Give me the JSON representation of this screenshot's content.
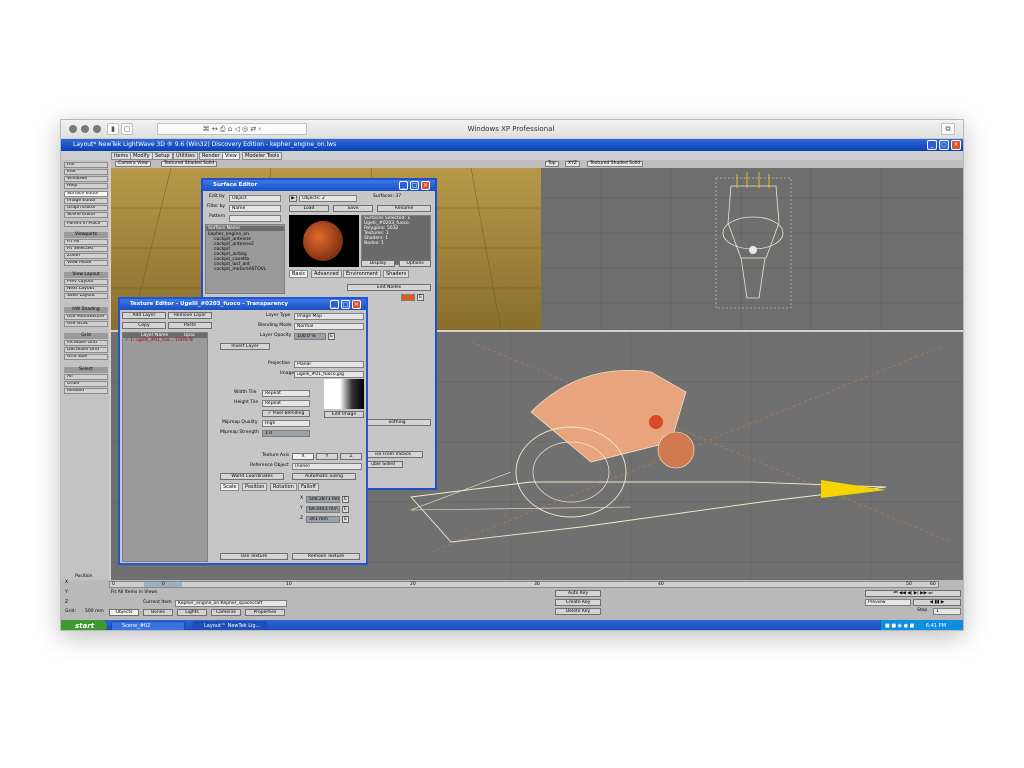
{
  "mac": {
    "window_title": "Windows XP Professional"
  },
  "app": {
    "title": "Layout* NewTek LightWave 3D ® 9.6 (Win32) Discovery Edition - kepher_engine_on.lws"
  },
  "menu_tabs": [
    "Items",
    "Modify",
    "Setup",
    "Utilities",
    "Render",
    "View",
    "Modeler Tools"
  ],
  "left_panel": {
    "items": [
      "File",
      "Edit",
      "Windows",
      "Help",
      "Surface Editor",
      "Image Editor",
      "Graph Editor",
      "Scene Editor",
      "Parent in Place"
    ],
    "viewports_head": "Viewports",
    "viewports": [
      "Fit All",
      "Fit Selected",
      "Zoom",
      "View Mode"
    ],
    "view_layout_head": "View Layout",
    "view_layout": [
      "Prev Layout",
      "Next Layout",
      "Save Layout"
    ],
    "shading_head": "HW Shading",
    "shading": [
      "Use Multitexture",
      "Use GLSL"
    ],
    "grid_head": "Grid",
    "grid": [
      "Increase Grid",
      "Decrease Grid",
      "Grid Size"
    ],
    "select_head": "Select",
    "select": [
      "All",
      "Order",
      "Related"
    ]
  },
  "viewports": {
    "left_top": {
      "view": "Camera View",
      "mode": "Textured Shaded Solid"
    },
    "right_top": {
      "view": "Top",
      "zoom": "XYZ",
      "mode": "Textured Shaded Solid"
    }
  },
  "surface_editor": {
    "title": "Surface Editor",
    "edit_by_label": "Edit by",
    "edit_by": "Object",
    "filter_by_label": "Filter by",
    "filter_by": "Name",
    "pattern_label": "Pattern",
    "objects_label": "Objects: 2",
    "surfaces_label": "Surfaces: 37",
    "load": "Load",
    "save": "Save",
    "rename": "Rename",
    "list_head": "Surface Name",
    "list": [
      "kepher_engine_on",
      "cockpit_antenne",
      "cockpit_antenne2",
      "cockpit",
      "cockpit_airbag",
      "cockpit_cavetto",
      "cockpit_luci_ant",
      "cockpit_motoreASTOVL"
    ],
    "info": [
      "Surfaces Selected: 1",
      "Ugelli_#0203_fuoco",
      "Polygons: 5632",
      "Textures: 1",
      "Shaders: 1",
      "Nodes: 1"
    ],
    "display": "Display",
    "options": "Options",
    "tabs": [
      "Basic",
      "Advanced",
      "Environment",
      "Shaders"
    ],
    "edit_nodes": "Edit Nodes",
    "partial_a": "oothing",
    "partial_b": "ise From VStack",
    "partial_c": "uble Sided"
  },
  "texture_editor": {
    "title": "Texture Editor - Ugelli_#0203_fuoco - Transparency",
    "add_layer": "Add Layer",
    "remove_layer": "Remove Layer",
    "copy": "Copy",
    "paste": "Paste",
    "cols": [
      "Layer Name",
      "Opac"
    ],
    "layer_name": "1: ugelli_#01_fuo...",
    "layer_opac": "100%",
    "layer_flag": "N",
    "layer_type_label": "Layer Type",
    "layer_type": "Image Map",
    "blending_label": "Blending Mode",
    "blending": "Normal",
    "opacity_label": "Layer Opacity",
    "opacity": "100.0 %",
    "invert": "Invert Layer",
    "projection_label": "Projection",
    "projection": "Planar",
    "image_label": "Image",
    "image": "ugelli_#01_fuoco.jpg",
    "width_tile_label": "Width Tile",
    "width_tile": "Repeat",
    "height_tile_label": "Height Tile",
    "height_tile": "Repeat",
    "pixel_blending": "Pixel Blending",
    "edit_image": "Edit Image",
    "mipmap_q_label": "Mipmap Quality",
    "mipmap_q": "High",
    "mipmap_s_label": "Mipmap Strength",
    "mipmap_s": "1.0",
    "axis_label": "Texture Axis",
    "axis": [
      "X",
      "Y",
      "Z"
    ],
    "ref_label": "Reference Object",
    "ref": "(none)",
    "world_coords": "World Coordinates",
    "auto_size": "Automatic Sizing",
    "tabs": [
      "Scale",
      "Position",
      "Rotation",
      "Falloff"
    ],
    "x_val": "500.2873 mm",
    "y_val": "69.4443 mm",
    "z_val": "391 mm",
    "use_texture": "Use Texture",
    "remove_texture": "Remove Texture"
  },
  "timeline": {
    "position_label": "Position",
    "ticks": [
      "0",
      "10",
      "20",
      "30",
      "40",
      "50",
      "60"
    ],
    "fit_all": "Fit All Items in Views",
    "current_item_label": "Current Item",
    "current_item": "Kepher_engine_on:Kepher_spacecraft",
    "grid_label": "Grid:",
    "grid_value": "500 mm",
    "objects": "Objects",
    "bones": "Bones",
    "lights": "Lights",
    "cameras": "Cameras",
    "properties": "Properties",
    "auto_key": "Auto Key",
    "create_key": "Create Key",
    "delete_key": "Delete Key",
    "preview": "Preview",
    "step_label": "Step",
    "step": "1",
    "xyz": [
      "X",
      "Y",
      "Z"
    ]
  },
  "taskbar": {
    "start": "start",
    "items": [
      "Scene_#02",
      "Layout™ NewTek Lig..."
    ],
    "clock": "6:41 PM"
  },
  "colors": {
    "xp_blue": "#0a3fb5",
    "start_green": "#3c9a2f",
    "wire": "#f2eecf",
    "viewport_gray": "#6e6e6e"
  }
}
